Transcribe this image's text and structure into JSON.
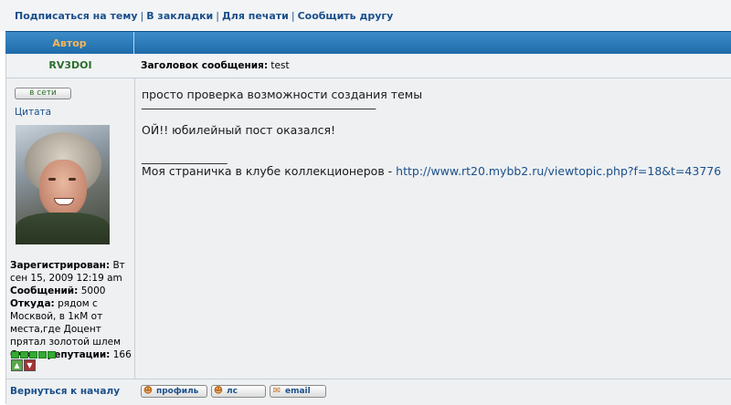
{
  "topnav": {
    "links": [
      "Подписаться на тему",
      "В закладки",
      "Для печати",
      "Сообщить другу"
    ],
    "separator": "|"
  },
  "header": {
    "author_label": "Автор"
  },
  "post": {
    "username": "RV3DOI",
    "subject_label": "Заголовок сообщения:",
    "subject_value": "test",
    "online_button": "в сети",
    "quote_link": "Цитата",
    "registered_label": "Зарегистрирован:",
    "registered_value": "Вт сен 15, 2009 12:19 am",
    "messages_label": "Сообщений:",
    "messages_value": "5000",
    "from_label": "Откуда:",
    "from_value": "рядом с Москвой, в 1кМ от места,где Доцент прятал золотой шлем",
    "reputation_label": "Очков репутации:",
    "reputation_value": "166",
    "body_line1": "просто проверка возможности создания темы",
    "body_line2": "_________________________________________",
    "body_line3": "ОЙ!! юбилейный пост оказался!",
    "signature_rule": "_______________",
    "signature_text": "Моя страничка в клубе коллекционеров - ",
    "signature_link": "http://www.rt20.mybb2.ru/viewtopic.php?f=18&t=43776"
  },
  "footer": {
    "back_to_top": "Вернуться к началу",
    "buttons": [
      "профиль",
      "лс",
      "email"
    ]
  },
  "colors": {
    "header_blue": "#1e6aa8",
    "author_orange": "#f7b65a",
    "link_blue": "#1b4f8a",
    "username_green": "#2c6e2c"
  }
}
